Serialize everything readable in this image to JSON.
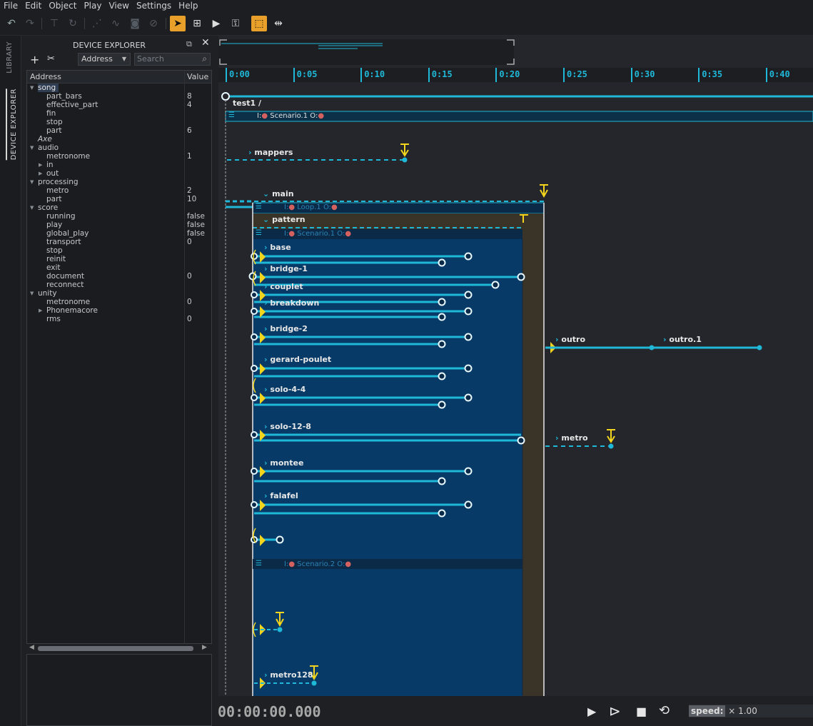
{
  "menu": [
    "File",
    "Edit",
    "Object",
    "Play",
    "View",
    "Settings",
    "Help"
  ],
  "toolbar": {
    "icons": [
      "undo-icon",
      "redo-icon",
      "merge-icon",
      "refresh-icon",
      "interpolate-icon",
      "curve-icon",
      "snapshot-icon",
      "snapshot-cancel-icon",
      "select-tool-icon",
      "create-tool-icon",
      "play-tool-icon",
      "lock-icon",
      "scale-icon",
      "split-icon"
    ]
  },
  "sidebar_tabs": {
    "library": "LIBRARY",
    "device_explorer": "DEVICE EXPLORER"
  },
  "device_explorer": {
    "title": "DEVICE EXPLORER",
    "address_select": "Address",
    "search_placeholder": "Search",
    "col_address": "Address",
    "col_value": "Value",
    "rows": [
      {
        "name": "song",
        "value": "",
        "depth": 0,
        "arrow": "down",
        "selected": true
      },
      {
        "name": "part_bars",
        "value": "8",
        "depth": 1
      },
      {
        "name": "effective_part",
        "value": "4",
        "depth": 1
      },
      {
        "name": "fin",
        "value": "",
        "depth": 1
      },
      {
        "name": "stop",
        "value": "",
        "depth": 1
      },
      {
        "name": "part",
        "value": "6",
        "depth": 1
      },
      {
        "name": "Axe",
        "value": "",
        "depth": 0,
        "italic": true
      },
      {
        "name": "audio",
        "value": "",
        "depth": 0,
        "arrow": "down"
      },
      {
        "name": "metronome",
        "value": "1",
        "depth": 1
      },
      {
        "name": "in",
        "value": "",
        "depth": 1,
        "arrow": "right"
      },
      {
        "name": "out",
        "value": "",
        "depth": 1,
        "arrow": "right"
      },
      {
        "name": "processing",
        "value": "",
        "depth": 0,
        "arrow": "down"
      },
      {
        "name": "metro",
        "value": "2",
        "depth": 1
      },
      {
        "name": "part",
        "value": "10",
        "depth": 1
      },
      {
        "name": "score",
        "value": "",
        "depth": 0,
        "arrow": "down"
      },
      {
        "name": "running",
        "value": "false",
        "depth": 1
      },
      {
        "name": "play",
        "value": "false",
        "depth": 1
      },
      {
        "name": "global_play",
        "value": "false",
        "depth": 1
      },
      {
        "name": "transport",
        "value": "0",
        "depth": 1
      },
      {
        "name": "stop",
        "value": "",
        "depth": 1
      },
      {
        "name": "reinit",
        "value": "",
        "depth": 1
      },
      {
        "name": "exit",
        "value": "",
        "depth": 1
      },
      {
        "name": "document",
        "value": "0",
        "depth": 1
      },
      {
        "name": "reconnect",
        "value": "",
        "depth": 1
      },
      {
        "name": "unity",
        "value": "",
        "depth": 0,
        "arrow": "down"
      },
      {
        "name": "metronome",
        "value": "0",
        "depth": 1
      },
      {
        "name": "Phonemacore",
        "value": "",
        "depth": 1,
        "arrow": "right"
      },
      {
        "name": "rms",
        "value": "0",
        "depth": 1
      }
    ]
  },
  "ruler": [
    "0:00",
    "0:05",
    "0:10",
    "0:15",
    "0:20",
    "0:25",
    "0:30",
    "0:35",
    "0:40"
  ],
  "scenario": {
    "root_name": "test1",
    "root_sep": "/",
    "root_scenario": "Scenario.1",
    "loop": "Loop.1",
    "inner_scenario": "Scenario.1",
    "second_scenario": "Scenario.2",
    "port_in": "I:",
    "port_out": "O:",
    "boxes": [
      "mappers",
      "main",
      "pattern",
      "base",
      "bridge-1",
      "couplet",
      "breakdown",
      "bridge-2",
      "gerard-poulet",
      "solo-4-4",
      "solo-12-8",
      "montee",
      "falafel",
      "metro128",
      "outro",
      "outro.1",
      "metro"
    ]
  },
  "transport": {
    "clock": "00:00:00.000",
    "speed_label": "speed:",
    "speed_value": "× 1.00"
  },
  "colors": {
    "accent": "#1fb8d8",
    "yellow": "#f2d51c",
    "orange": "#e8a02b",
    "scenario_bg": "#073a66",
    "loop_bg": "#3a3328"
  }
}
